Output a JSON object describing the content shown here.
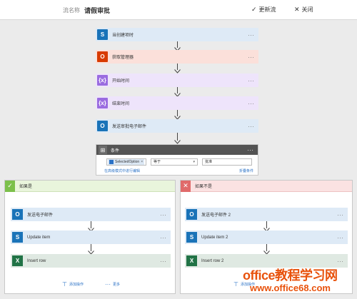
{
  "header": {
    "name_label": "流名称",
    "title": "请假审批",
    "update_label": "更新流",
    "close_label": "关闭"
  },
  "steps": [
    {
      "label": "当创建项时",
      "icon": "sharepoint-icon",
      "color": "#1a73b8",
      "bg": "#deeaf6"
    },
    {
      "label": "获取管理器",
      "icon": "office-icon",
      "color": "#d83b01",
      "bg": "#fbe0da"
    },
    {
      "label": "开始时间",
      "icon": "expression-icon",
      "color": "#9a6ce0",
      "bg": "#eee4fb"
    },
    {
      "label": "结束时间",
      "icon": "expression-icon",
      "color": "#9a6ce0",
      "bg": "#eee4fb"
    },
    {
      "label": "发送审批电子邮件",
      "icon": "outlook-icon",
      "color": "#1a73b8",
      "bg": "#deeaf6"
    }
  ],
  "condition": {
    "label": "条件",
    "token_label": "SelectedOption",
    "operator": "等于",
    "value": "批准",
    "advanced_link": "在高级模式中进行编辑",
    "collapse_link": "折叠条件"
  },
  "yes_branch": {
    "label": "如果是",
    "steps": [
      {
        "label": "发送电子邮件",
        "icon": "outlook-icon",
        "color": "#1a73b8",
        "bg": "#deeaf6"
      },
      {
        "label": "Update item",
        "icon": "sharepoint-icon",
        "color": "#1a73b8",
        "bg": "#deeaf6"
      },
      {
        "label": "Insert row",
        "icon": "excel-icon",
        "color": "#217346",
        "bg": "#dfe9e2"
      }
    ],
    "add_action": "添加操作",
    "more": "更多"
  },
  "no_branch": {
    "label": "如果不是",
    "steps": [
      {
        "label": "发送电子邮件 2",
        "icon": "outlook-icon",
        "color": "#1a73b8",
        "bg": "#deeaf6"
      },
      {
        "label": "Update item 2",
        "icon": "sharepoint-icon",
        "color": "#1a73b8",
        "bg": "#deeaf6"
      },
      {
        "label": "Insert row 2",
        "icon": "excel-icon",
        "color": "#217346",
        "bg": "#dfe9e2"
      }
    ],
    "add_action": "添加操作"
  },
  "watermark": {
    "line1": "office教程学习网",
    "line2": "www.office68.com"
  }
}
